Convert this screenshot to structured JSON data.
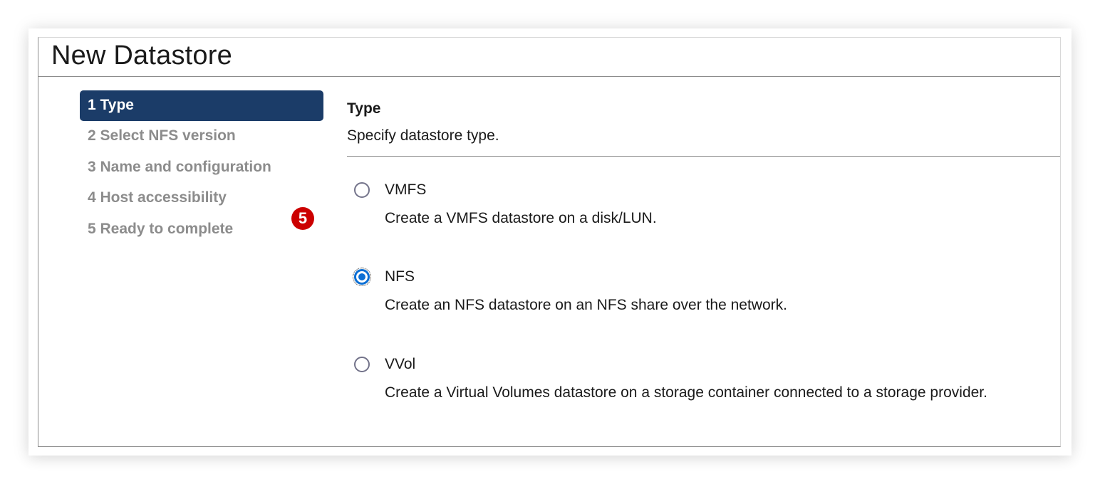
{
  "dialog": {
    "title": "New Datastore"
  },
  "steps": [
    {
      "label": "1 Type",
      "active": true
    },
    {
      "label": "2 Select NFS version",
      "active": false
    },
    {
      "label": "3 Name and configuration",
      "active": false
    },
    {
      "label": "4 Host accessibility",
      "active": false
    },
    {
      "label": "5 Ready to complete",
      "active": false
    }
  ],
  "content": {
    "title": "Type",
    "description": "Specify datastore type.",
    "options": [
      {
        "label": "VMFS",
        "description": "Create a VMFS datastore on a disk/LUN.",
        "selected": false
      },
      {
        "label": "NFS",
        "description": "Create an NFS datastore on an NFS share over the network.",
        "selected": true
      },
      {
        "label": "VVol",
        "description": "Create a Virtual Volumes datastore on a storage container connected to a storage provider.",
        "selected": false
      }
    ]
  },
  "annotation": {
    "badge_number": "5"
  },
  "colors": {
    "active_step_bg": "#1b3c68",
    "radio_checked": "#0c6fd4",
    "badge": "#cc0000"
  }
}
